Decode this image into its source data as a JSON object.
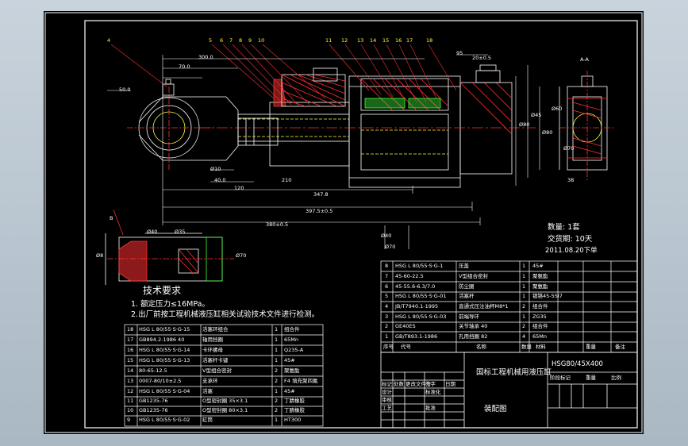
{
  "part_numbers": [
    "4",
    "5",
    "6",
    "7",
    "8",
    "9",
    "10",
    "11",
    "12",
    "13",
    "14",
    "15",
    "16",
    "17",
    "18"
  ],
  "side_labels": [
    "A-A",
    "B"
  ],
  "dims": [
    "300.0",
    "70.0",
    "50.0",
    "95",
    "Ø80",
    "Ø45",
    "Ø80",
    "Ø60",
    "Ø70",
    "40.0",
    "120",
    "210",
    "Ø40",
    "Ø70",
    "Ø10",
    "Ø40",
    "Ø35",
    "20±0.5",
    "38",
    "Ø8",
    "Ø70"
  ],
  "dims_long": [
    "347.8",
    "397.5±0.5",
    "380±0.5"
  ],
  "notes": {
    "qty": "数量: 1套",
    "delivery": "交货期: 10天",
    "date": "2011.08.20下单"
  },
  "tech": {
    "title": "技术要求",
    "line1": "1. 额定压力≤16MPa。",
    "line2": "2.出厂前按工程机械液压缸相关试验技术文件进行检测。"
  },
  "bom_right": [
    {
      "no": "8",
      "code": "HSG L 80/55·S·G-1",
      "name": "压盖",
      "qty": "1",
      "mat": "45#"
    },
    {
      "no": "7",
      "code": "45-60-22.5",
      "name": "V型组合密封",
      "qty": "1",
      "mat": "聚氨酯"
    },
    {
      "no": "6",
      "code": "45-55.6-6.3/7.0",
      "name": "防尘圈",
      "qty": "1",
      "mat": "聚氨酯"
    },
    {
      "no": "5",
      "code": "HSG L 80/55·S·G-01",
      "name": "活塞杆",
      "qty": "1",
      "mat": "镀铬45-55I7"
    },
    {
      "no": "4",
      "code": "JB/T7940.1-1995",
      "name": "直通式压注油杯M8*1",
      "qty": "2",
      "mat": "组合件"
    },
    {
      "no": "3",
      "code": "HSG L 80/55·S·G-03",
      "name": "前端导环",
      "qty": "1",
      "mat": "ZG35"
    },
    {
      "no": "2",
      "code": "GE40ES",
      "name": "关节轴承 40",
      "qty": "2",
      "mat": "组合件"
    },
    {
      "no": "1",
      "code": "GB/T893.1-1986",
      "name": "孔用挡圈 82",
      "qty": "4",
      "mat": "65Mn"
    }
  ],
  "bom_right_header": {
    "no": "序号",
    "code": "代号",
    "name": "名称",
    "qty": "数量",
    "mat": "材料",
    "weight": "重量",
    "note": "备注"
  },
  "bom_left": [
    {
      "no": "18",
      "code": "HSG L 80/55·S·G-15",
      "name": "活塞环组合",
      "qty": "1",
      "mat": "组合件"
    },
    {
      "no": "17",
      "code": "GB894.2-1986 40",
      "name": "轴用挡圈",
      "qty": "1",
      "mat": "65Mn"
    },
    {
      "no": "16",
      "code": "HSG L 80/55·S·G-14",
      "name": "卡环螺母",
      "qty": "1",
      "mat": "Q235-A"
    },
    {
      "no": "15",
      "code": "HSG L 80/55·S·G-13",
      "name": "活塞杆卡键",
      "qty": "1",
      "mat": "45#"
    },
    {
      "no": "14",
      "code": "80-65-12.5",
      "name": "V型组合密封",
      "qty": "2",
      "mat": "聚氨酯"
    },
    {
      "no": "13",
      "code": "0007-80/10±2.5",
      "name": "支承环",
      "qty": "2",
      "mat": "F4 填充聚四氟"
    },
    {
      "no": "12",
      "code": "HSG L 80/55·S·G-04",
      "name": "活塞",
      "qty": "1",
      "mat": "45#"
    },
    {
      "no": "11",
      "code": "GB1235-76",
      "name": "O型密封圈 35×3.1",
      "qty": "2",
      "mat": "丁腈橡胶"
    },
    {
      "no": "10",
      "code": "GB1235-76",
      "name": "O型密封圈 80×3.1",
      "qty": "2",
      "mat": "丁腈橡胶"
    },
    {
      "no": "9",
      "code": "HSG L 80/55·S·G-02",
      "name": "缸筒",
      "qty": "1",
      "mat": "HT300"
    }
  ],
  "title_block": {
    "drawing_no": "HSG80/45X400",
    "name": "国标工程机械用液压缸",
    "type": "装配图",
    "rows": [
      "标记",
      "处数",
      "更改文件号",
      "签字",
      "日期"
    ],
    "roles": [
      "设计",
      "标准化",
      "审核",
      "工艺",
      "批准"
    ],
    "cols": [
      "阶段标记",
      "重量",
      "比例"
    ]
  },
  "colors": {
    "bg": "#000000",
    "outline": "#ffffff",
    "hidden": "#ffff40",
    "center": "#ff3030",
    "hatch": "#ff3030",
    "dim": "#ffffff",
    "accent": "#40ff40"
  }
}
